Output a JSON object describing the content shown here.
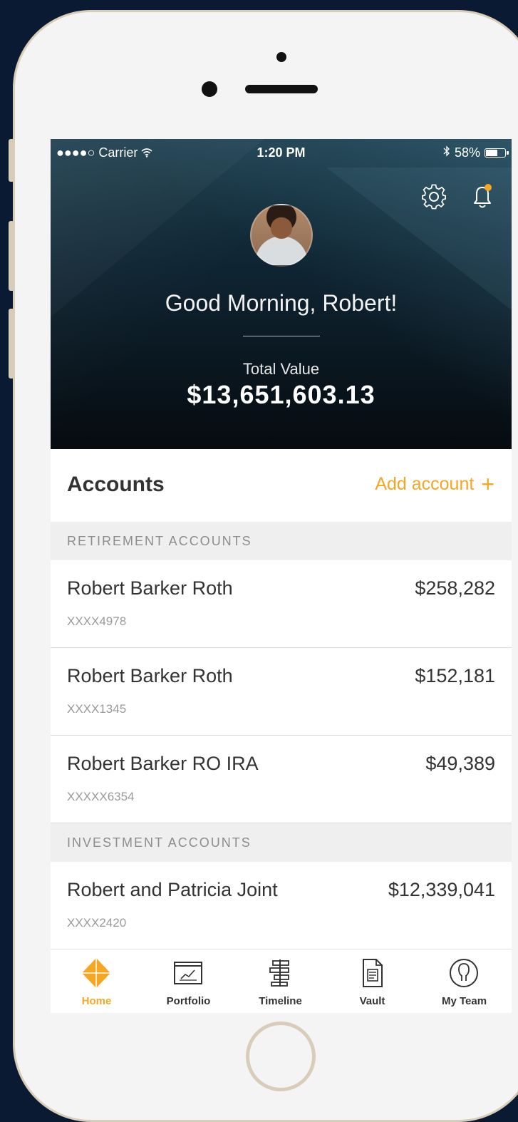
{
  "status_bar": {
    "signal": "●●●●○ Carrier",
    "wifi": "wifi-icon",
    "time": "1:20 PM",
    "bluetooth": "bluetooth-icon",
    "battery_text": "58%",
    "battery_level": 0.58
  },
  "header": {
    "icons": [
      "gear-icon",
      "bell-icon"
    ],
    "greeting": "Good Morning, Robert!",
    "total_label": "Total Value",
    "total_value": "$13,651,603.13"
  },
  "accounts": {
    "title": "Accounts",
    "add_label": "Add account",
    "add_icon": "+",
    "sections": [
      {
        "title": "RETIREMENT ACCOUNTS",
        "items": [
          {
            "name": "Robert Barker Roth",
            "amount": "$258,282",
            "number": "XXXX4978"
          },
          {
            "name": "Robert Barker Roth",
            "amount": "$152,181",
            "number": "XXXX1345"
          },
          {
            "name": "Robert Barker RO IRA",
            "amount": "$49,389",
            "number": "XXXXX6354"
          }
        ]
      },
      {
        "title": "INVESTMENT ACCOUNTS",
        "items": [
          {
            "name": "Robert and Patricia Joint",
            "amount": "$12,339,041",
            "number": "XXXX2420"
          }
        ]
      }
    ]
  },
  "tabs": [
    {
      "label": "Home",
      "icon": "home-diamond-icon",
      "active": true
    },
    {
      "label": "Portfolio",
      "icon": "portfolio-chart-icon",
      "active": false
    },
    {
      "label": "Timeline",
      "icon": "timeline-icon",
      "active": false
    },
    {
      "label": "Vault",
      "icon": "vault-document-icon",
      "active": false
    },
    {
      "label": "My Team",
      "icon": "team-person-icon",
      "active": false
    }
  ],
  "colors": {
    "accent": "#f5a623",
    "text": "#333333",
    "muted": "#9a9a9a",
    "background": "#0b1a33"
  }
}
